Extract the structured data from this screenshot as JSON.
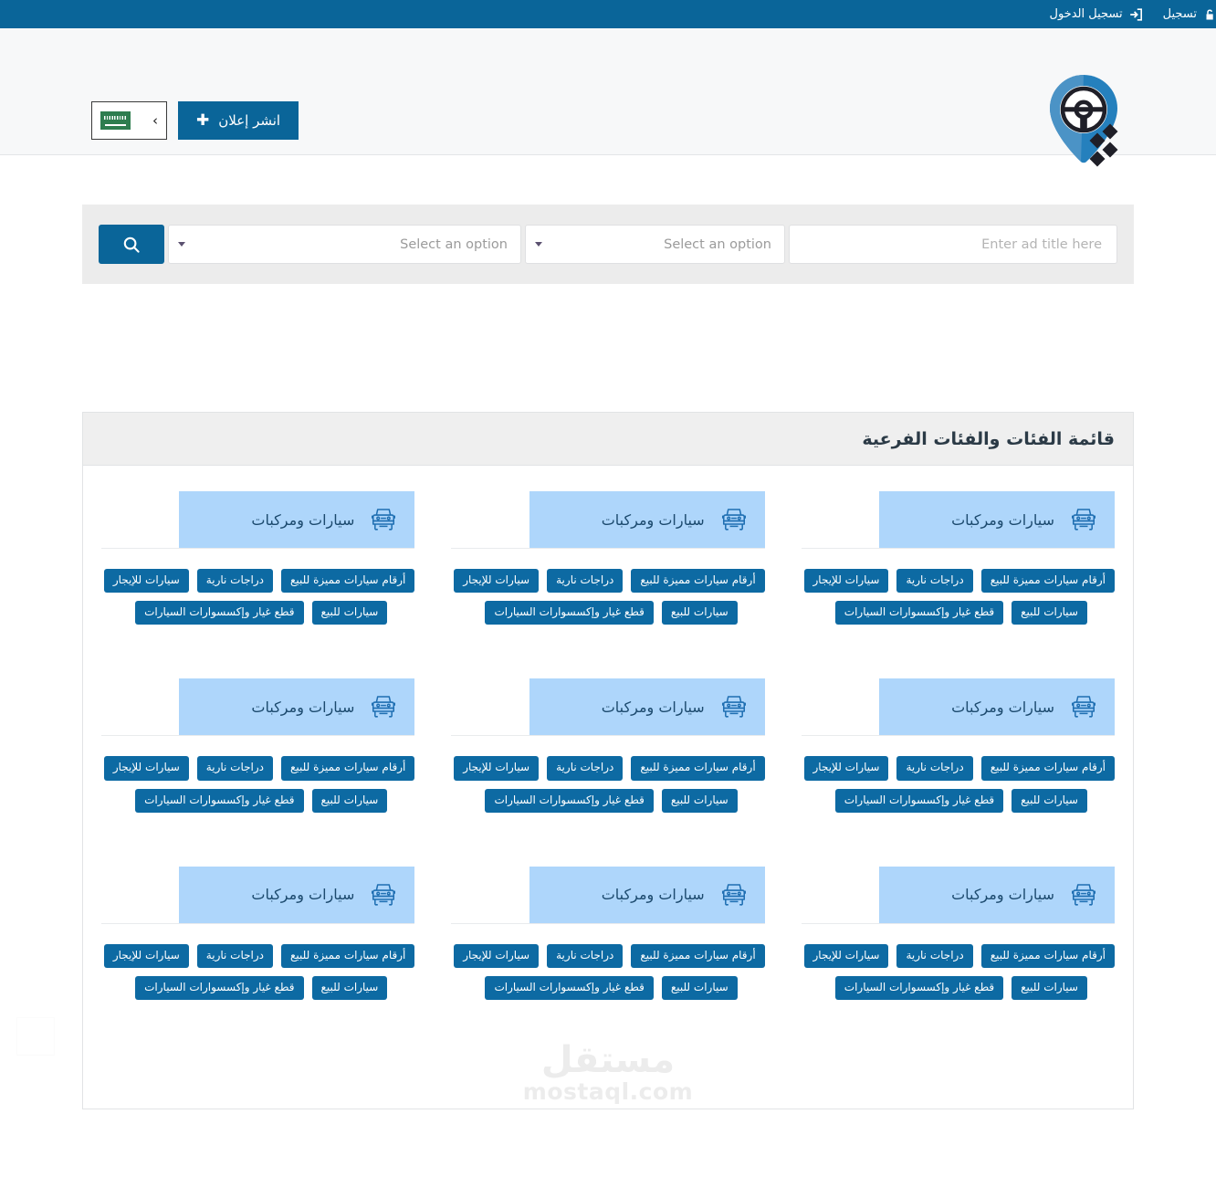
{
  "topbar": {
    "links": [
      {
        "label": "تسجيل الدخول",
        "icon": "login-icon"
      },
      {
        "label": "تسجيل",
        "icon": "signup-unlock-icon"
      }
    ]
  },
  "header": {
    "post_ad_label": "انشر إعلان",
    "post_ad_plus": "✚",
    "lang_switch": {
      "flag": "saudi-flag",
      "chevron": "›"
    },
    "logo": "car-location-pin-logo"
  },
  "search": {
    "search_icon": "search-icon",
    "category_placeholder": "Select an option",
    "city_placeholder": "Select an option",
    "title_placeholder": "Enter ad title here",
    "title_value": ""
  },
  "categories_panel": {
    "title": "قائمة الفئات والفئات الفرعية",
    "cards": [
      {
        "name": "سيارات ومركبات",
        "icon": "suv-front-icon",
        "tags_row1": [
          "أرقام سيارات مميزة للبيع",
          "دراجات نارية",
          "سيارات للإيجار"
        ],
        "tags_row2": [
          "سيارات للبيع",
          "قطع غيار وإكسسوارات السيارات"
        ]
      },
      {
        "name": "سيارات ومركبات",
        "icon": "suv-front-icon",
        "tags_row1": [
          "أرقام سيارات مميزة للبيع",
          "دراجات نارية",
          "سيارات للإيجار"
        ],
        "tags_row2": [
          "سيارات للبيع",
          "قطع غيار وإكسسوارات السيارات"
        ]
      },
      {
        "name": "سيارات ومركبات",
        "icon": "suv-front-icon",
        "tags_row1": [
          "أرقام سيارات مميزة للبيع",
          "دراجات نارية",
          "سيارات للإيجار"
        ],
        "tags_row2": [
          "سيارات للبيع",
          "قطع غيار وإكسسوارات السيارات"
        ]
      },
      {
        "name": "سيارات ومركبات",
        "icon": "suv-front-icon",
        "tags_row1": [
          "أرقام سيارات مميزة للبيع",
          "دراجات نارية",
          "سيارات للإيجار"
        ],
        "tags_row2": [
          "سيارات للبيع",
          "قطع غيار وإكسسوارات السيارات"
        ]
      },
      {
        "name": "سيارات ومركبات",
        "icon": "suv-front-icon",
        "tags_row1": [
          "أرقام سيارات مميزة للبيع",
          "دراجات نارية",
          "سيارات للإيجار"
        ],
        "tags_row2": [
          "سيارات للبيع",
          "قطع غيار وإكسسوارات السيارات"
        ]
      },
      {
        "name": "سيارات ومركبات",
        "icon": "suv-front-icon",
        "tags_row1": [
          "أرقام سيارات مميزة للبيع",
          "دراجات نارية",
          "سيارات للإيجار"
        ],
        "tags_row2": [
          "سيارات للبيع",
          "قطع غيار وإكسسوارات السيارات"
        ]
      },
      {
        "name": "سيارات ومركبات",
        "icon": "suv-front-icon",
        "tags_row1": [
          "أرقام سيارات مميزة للبيع",
          "دراجات نارية",
          "سيارات للإيجار"
        ],
        "tags_row2": [
          "سيارات للبيع",
          "قطع غيار وإكسسوارات السيارات"
        ]
      },
      {
        "name": "سيارات ومركبات",
        "icon": "suv-front-icon",
        "tags_row1": [
          "أرقام سيارات مميزة للبيع",
          "دراجات نارية",
          "سيارات للإيجار"
        ],
        "tags_row2": [
          "سيارات للبيع",
          "قطع غيار وإكسسوارات السيارات"
        ]
      },
      {
        "name": "سيارات ومركبات",
        "icon": "suv-front-icon",
        "tags_row1": [
          "أرقام سيارات مميزة للبيع",
          "دراجات نارية",
          "سيارات للإيجار"
        ],
        "tags_row2": [
          "سيارات للبيع",
          "قطع غيار وإكسسوارات السيارات"
        ]
      }
    ]
  },
  "watermark": {
    "arabic": "مستقل",
    "latin": "mostaql.com"
  },
  "colors": {
    "brand_blue": "#0a6599",
    "tag_blue": "#0d6aa3",
    "card_header_blue": "#aed6fb",
    "search_strip_gray": "#ececec",
    "panel_head_gray": "#efefef",
    "header_gray": "#f7f8f9"
  }
}
